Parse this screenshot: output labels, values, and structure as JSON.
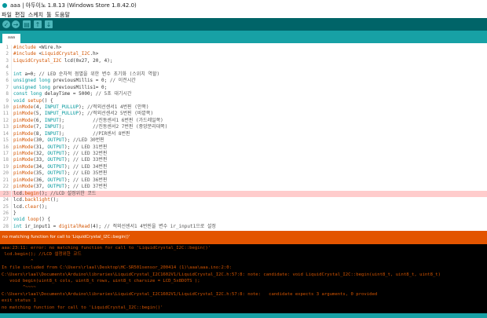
{
  "window": {
    "title": "aaa | 아두이노 1.8.13 (Windows Store 1.8.42.0)"
  },
  "menu": [
    "파일",
    "편집",
    "스케치",
    "툴",
    "도움말"
  ],
  "toolbar": {
    "icons": [
      "verify-icon",
      "upload-icon",
      "new-icon",
      "open-icon",
      "save-icon"
    ],
    "glyphs": [
      "✓",
      "→",
      "▤",
      "↑",
      "↓"
    ]
  },
  "tab": {
    "label": "aaa"
  },
  "colors": {
    "toolbar": "#006468",
    "tabbar": "#17a1a5",
    "error_bar": "#e35500",
    "highlight": "#ffcccc",
    "keyword": "#00979c",
    "function": "#d35400"
  },
  "editor": {
    "highlighted_line": 23,
    "lines": [
      [
        [
          "#include ",
          "f"
        ],
        [
          "<Wire.h>",
          "p"
        ]
      ],
      [
        [
          "#include ",
          "f"
        ],
        [
          "<",
          "p"
        ],
        [
          "LiquidCrystal_I2C",
          "f"
        ],
        [
          ".h>",
          "p"
        ]
      ],
      [
        [
          "LiquidCrystal_I2C",
          "f"
        ],
        [
          " lcd(0x27, 20, 4);",
          "p"
        ]
      ],
      [],
      [
        [
          "int",
          "k"
        ],
        [
          " a=0; ",
          "p"
        ],
        [
          "// LED 순차적 점멸을 위한 변수 초기화 (스위치 역할)",
          "m"
        ]
      ],
      [
        [
          "unsigned",
          "k"
        ],
        [
          " ",
          "p"
        ],
        [
          "long",
          "k"
        ],
        [
          " previousMillis = 0; ",
          "p"
        ],
        [
          "// 이전시간",
          "m"
        ]
      ],
      [
        [
          "unsigned",
          "k"
        ],
        [
          " ",
          "p"
        ],
        [
          "long",
          "k"
        ],
        [
          " previousMillis1= 0;",
          "p"
        ]
      ],
      [
        [
          "const",
          "k"
        ],
        [
          " ",
          "p"
        ],
        [
          "long",
          "k"
        ],
        [
          " delayTime = 5000; ",
          "p"
        ],
        [
          "// 5초 대기시간",
          "m"
        ]
      ],
      [
        [
          "void",
          "k"
        ],
        [
          " ",
          "p"
        ],
        [
          "setup",
          "f"
        ],
        [
          "() {",
          "p"
        ]
      ],
      [
        [
          "pinMode",
          "f"
        ],
        [
          "(4, ",
          "p"
        ],
        [
          "INPUT_PULLUP",
          "c"
        ],
        [
          "); ",
          "p"
        ],
        [
          "//적외선센서1 4번핀 (안쪽)",
          "m"
        ]
      ],
      [
        [
          "pinMode",
          "f"
        ],
        [
          "(5, ",
          "p"
        ],
        [
          "INPUT_PULLUP",
          "c"
        ],
        [
          "); ",
          "p"
        ],
        [
          "//적외선센서2 5번핀 (바깥쪽)",
          "m"
        ]
      ],
      [
        [
          "pinMode",
          "f"
        ],
        [
          "(6, ",
          "p"
        ],
        [
          "INPUT",
          "c"
        ],
        [
          ");          ",
          "p"
        ],
        [
          "//진동센서1 6번핀 (가드레일쪽)",
          "m"
        ]
      ],
      [
        [
          "pinMode",
          "f"
        ],
        [
          "(7, ",
          "p"
        ],
        [
          "INPUT",
          "c"
        ],
        [
          ");          ",
          "p"
        ],
        [
          "//진동센서2 7번핀 (중앙분리대쪽)",
          "m"
        ]
      ],
      [
        [
          "pinMode",
          "f"
        ],
        [
          "(8, ",
          "p"
        ],
        [
          "INPUT",
          "c"
        ],
        [
          ");          ",
          "p"
        ],
        [
          "//PIR센서 8번핀",
          "m"
        ]
      ],
      [
        [
          "pinMode",
          "f"
        ],
        [
          "(30, ",
          "p"
        ],
        [
          "OUTPUT",
          "c"
        ],
        [
          "); ",
          "p"
        ],
        [
          "//LED 30번핀",
          "m"
        ]
      ],
      [
        [
          "pinMode",
          "f"
        ],
        [
          "(31, ",
          "p"
        ],
        [
          "OUTPUT",
          "c"
        ],
        [
          "); ",
          "p"
        ],
        [
          "// LED 31번핀",
          "m"
        ]
      ],
      [
        [
          "pinMode",
          "f"
        ],
        [
          "(32, ",
          "p"
        ],
        [
          "OUTPUT",
          "c"
        ],
        [
          "); ",
          "p"
        ],
        [
          "// LED 32번핀",
          "m"
        ]
      ],
      [
        [
          "pinMode",
          "f"
        ],
        [
          "(33, ",
          "p"
        ],
        [
          "OUTPUT",
          "c"
        ],
        [
          "); ",
          "p"
        ],
        [
          "// LED 33번핀",
          "m"
        ]
      ],
      [
        [
          "pinMode",
          "f"
        ],
        [
          "(34, ",
          "p"
        ],
        [
          "OUTPUT",
          "c"
        ],
        [
          "); ",
          "p"
        ],
        [
          "// LED 34번핀",
          "m"
        ]
      ],
      [
        [
          "pinMode",
          "f"
        ],
        [
          "(35, ",
          "p"
        ],
        [
          "OUTPUT",
          "c"
        ],
        [
          "); ",
          "p"
        ],
        [
          "// LED 35번핀",
          "m"
        ]
      ],
      [
        [
          "pinMode",
          "f"
        ],
        [
          "(36, ",
          "p"
        ],
        [
          "OUTPUT",
          "c"
        ],
        [
          "); ",
          "p"
        ],
        [
          "// LED 36번핀",
          "m"
        ]
      ],
      [
        [
          "pinMode",
          "f"
        ],
        [
          "(37, ",
          "p"
        ],
        [
          "OUTPUT",
          "c"
        ],
        [
          "); ",
          "p"
        ],
        [
          "// LED 37번핀",
          "m"
        ]
      ],
      [
        [
          "lcd.",
          "p"
        ],
        [
          "begin",
          "f"
        ],
        [
          "(); ",
          "p"
        ],
        [
          "//LCD 설정위한 코드",
          "m"
        ]
      ],
      [
        [
          "lcd.",
          "p"
        ],
        [
          "backlight",
          "f"
        ],
        [
          "();",
          "p"
        ]
      ],
      [
        [
          "lcd.",
          "p"
        ],
        [
          "clear",
          "f"
        ],
        [
          "();",
          "p"
        ]
      ],
      [
        [
          "}",
          "p"
        ]
      ],
      [
        [
          "void",
          "k"
        ],
        [
          " ",
          "p"
        ],
        [
          "loop",
          "f"
        ],
        [
          "() {",
          "p"
        ]
      ],
      [
        [
          "int",
          "k"
        ],
        [
          " ir_input1 = ",
          "p"
        ],
        [
          "digitalRead",
          "f"
        ],
        [
          "(4); ",
          "p"
        ],
        [
          "// 적외선센서1 4번핀을 변수 ir_input1으로 설정",
          "m"
        ]
      ]
    ]
  },
  "status": {
    "message": "no matching function for call to 'LiquidCrystal_I2C::begin()'"
  },
  "console": {
    "lines": [
      "aaa:23:11: error: no matching function for call to 'LiquidCrystal_I2C::begin()'",
      " lcd.begin(); //LCD 설정위한 코드",
      "           ^",
      "In file included from C:\\Users\\rlaal\\Desktop\\HC-SR501sensor_200414 (1)\\aaa\\aaa.ino:2:0:",
      "C:\\Users\\rlaal\\Documents\\Arduino\\libraries\\LiquidCrystal_I2C1602V1/LiquidCrystal_I2C.h:57:8: note: candidate: void LiquidCrystal_I2C::begin(uint8_t, uint8_t, uint8_t)",
      "   void begin(uint8_t cols, uint8_t rows, uint8_t charsize = LCD_5x8DOTS );",
      "        ^~~~~",
      "C:\\Users\\rlaal\\Documents\\Arduino\\libraries\\LiquidCrystal_I2C1602V1/LiquidCrystal_I2C.h:57:8: note:   candidate expects 3 arguments, 0 provided",
      "exit status 1",
      "no matching function for call to 'LiquidCrystal_I2C::begin()'"
    ]
  }
}
